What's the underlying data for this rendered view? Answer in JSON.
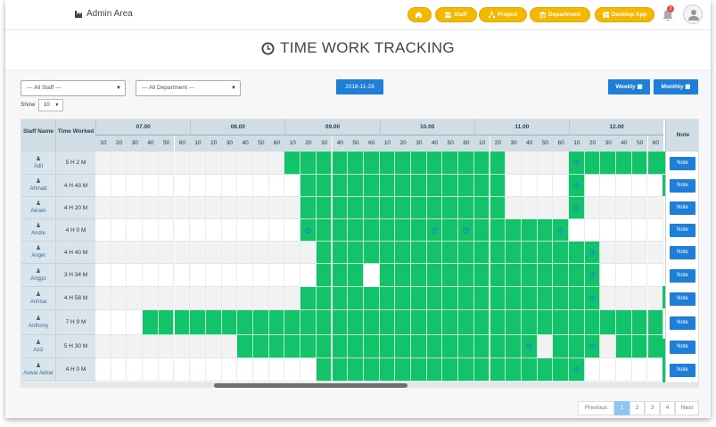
{
  "header": {
    "brand": "Admin Area",
    "nav": [
      {
        "label": "",
        "icon": "home-icon"
      },
      {
        "label": "Staff",
        "icon": "users-icon"
      },
      {
        "label": "Project",
        "icon": "sitemap-icon"
      },
      {
        "label": "Department",
        "icon": "building-icon"
      },
      {
        "label": "Desktop App",
        "icon": "windows-icon"
      }
    ],
    "notification_count": "2"
  },
  "page_title": "TIME WORK TRACKING",
  "filters": {
    "staff": "--- All Staff ---",
    "department": "--- All Department ---",
    "date": "2018-11-28",
    "weekly_label": "Weekly",
    "monthly_label": "Monthly",
    "show_label": "Show",
    "show_value": "10"
  },
  "table": {
    "staff_header": "Staff Name",
    "time_header": "Time Worked",
    "note_header": "Note",
    "hours": [
      "07.00",
      "08.00",
      "09.00",
      "10.00",
      "11.00",
      "12.00"
    ],
    "minutes": [
      "10",
      "20",
      "30",
      "40",
      "50",
      "60"
    ],
    "note_label": "Note",
    "rows": [
      {
        "name": "Adit",
        "time": "5 H 2 M",
        "on": [
          [
            12,
            19
          ],
          [
            20,
            25
          ],
          [
            30,
            35
          ]
        ],
        "pins": [
          30
        ]
      },
      {
        "name": "Ahmad",
        "time": "4 H 43 M",
        "on": [
          [
            13,
            19
          ],
          [
            20,
            25
          ],
          [
            30,
            30
          ]
        ],
        "pins": [
          30
        ]
      },
      {
        "name": "Akram",
        "time": "4 H 20 M",
        "on": [
          [
            13,
            19
          ],
          [
            20,
            25
          ],
          [
            30,
            30
          ]
        ],
        "pins": [
          30
        ]
      },
      {
        "name": "Andre",
        "time": "4 H 0 M",
        "on": [
          [
            13,
            18
          ],
          [
            19,
            29
          ]
        ],
        "pins": [
          13,
          21,
          23,
          29
        ]
      },
      {
        "name": "Angel",
        "time": "4 H 40 M",
        "on": [
          [
            14,
            18
          ],
          [
            19,
            29
          ],
          [
            30,
            31
          ]
        ],
        "pins": [
          31
        ]
      },
      {
        "name": "Anggo",
        "time": "3 H 34 M",
        "on": [
          [
            14,
            16
          ],
          [
            18,
            29
          ],
          [
            30,
            31
          ]
        ],
        "pins": [
          31
        ]
      },
      {
        "name": "Annisa",
        "time": "4 H 58 M",
        "on": [
          [
            13,
            19
          ],
          [
            20,
            29
          ],
          [
            30,
            31
          ]
        ],
        "pins": [
          31
        ]
      },
      {
        "name": "Anthony",
        "time": "7 H 9 M",
        "on": [
          [
            3,
            35
          ]
        ],
        "pins": []
      },
      {
        "name": "Aziz",
        "time": "5 H 30 M",
        "on": [
          [
            9,
            27
          ],
          [
            29,
            29
          ],
          [
            30,
            31
          ],
          [
            33,
            35
          ]
        ],
        "pins": [
          27,
          31
        ]
      },
      {
        "name": "Aswar Akbar",
        "time": "4 H 0 M",
        "on": [
          [
            14,
            29
          ],
          [
            30,
            30
          ]
        ],
        "pins": [
          30
        ]
      }
    ]
  },
  "pagination": {
    "previous": "Previous",
    "pages": [
      "1",
      "2",
      "3",
      "4"
    ],
    "next": "Next",
    "active": "1"
  },
  "colors": {
    "accent": "#1e7fd8",
    "nav": "#f5b800",
    "active_cell": "#12c36a"
  }
}
